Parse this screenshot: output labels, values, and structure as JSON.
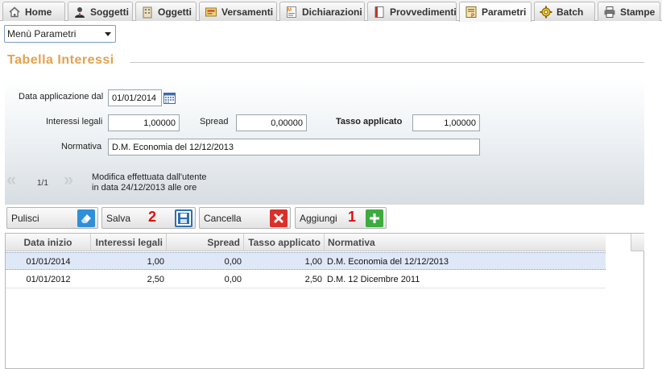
{
  "tabs": [
    {
      "label": "Home",
      "icon": "home-icon"
    },
    {
      "label": "Soggetti",
      "icon": "person-icon"
    },
    {
      "label": "Oggetti",
      "icon": "building-icon"
    },
    {
      "label": "Versamenti",
      "icon": "payment-icon"
    },
    {
      "label": "Dichiarazioni",
      "icon": "declaration-icon"
    },
    {
      "label": "Provvedimenti",
      "icon": "document-icon"
    },
    {
      "label": "Parametri",
      "icon": "parameters-icon"
    },
    {
      "label": "Batch",
      "icon": "batch-gear-icon"
    },
    {
      "label": "Stampe",
      "icon": "printer-icon"
    }
  ],
  "active_tab": "Parametri",
  "menu_select": {
    "value": "Menù Parametri"
  },
  "section_title": "Tabella Interessi",
  "form": {
    "data_applicazione_label": "Data applicazione dal",
    "data_applicazione_value": "01/01/2014",
    "interessi_legali_label": "Interessi legali",
    "interessi_legali_value": "1,00000",
    "spread_label": "Spread",
    "spread_value": "0,00000",
    "tasso_applicato_label": "Tasso applicato",
    "tasso_applicato_value": "1,00000",
    "normativa_label": "Normativa",
    "normativa_value": "D.M. Economia del 12/12/2013"
  },
  "pager": {
    "text": "1/1",
    "info_line1": "Modifica effettuata dall'utente",
    "info_line2": "in data 24/12/2013 alle ore"
  },
  "toolbar": {
    "pulisci": "Pulisci",
    "salva": "Salva",
    "cancella": "Cancella",
    "aggiungi": "Aggiungi",
    "marker_salva": "2",
    "marker_aggiungi": "1"
  },
  "grid": {
    "columns": [
      "Data inizio",
      "Interessi legali",
      "Spread",
      "Tasso applicato",
      "Normativa"
    ],
    "rows": [
      {
        "data_inizio": "01/01/2014",
        "interessi_legali": "1,00",
        "spread": "0,00",
        "tasso_applicato": "1,00",
        "normativa": "D.M. Economia del 12/12/2013",
        "selected": true
      },
      {
        "data_inizio": "01/01/2012",
        "interessi_legali": "2,50",
        "spread": "0,00",
        "tasso_applicato": "2,50",
        "normativa": "D.M. 12 Dicembre 2011",
        "selected": false
      }
    ]
  },
  "colors": {
    "title": "#e5a14d",
    "marker": "#e01010",
    "selected_row": "#dfe8f6"
  }
}
